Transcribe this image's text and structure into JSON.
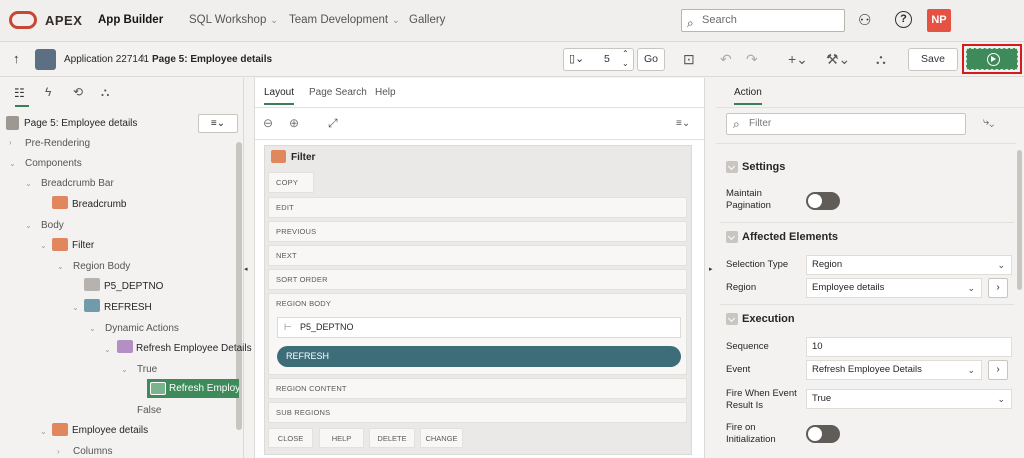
{
  "topnav": {
    "brand": "APEX",
    "items": [
      {
        "label": "App Builder",
        "active": true
      },
      {
        "label": "SQL Workshop",
        "active": false
      },
      {
        "label": "Team Development",
        "active": false
      },
      {
        "label": "Gallery",
        "active": false
      }
    ],
    "search_placeholder": "Search",
    "avatar_initials": "NP"
  },
  "toolbar": {
    "application": "Application 227141",
    "separator": "\\",
    "page": "Page 5: Employee details",
    "page_number": "5",
    "go_label": "Go",
    "save_label": "Save"
  },
  "left": {
    "title": "Page 5: Employee details",
    "tree": [
      {
        "label": "Pre-Rendering"
      },
      {
        "label": "Components"
      },
      {
        "label": "Breadcrumb Bar"
      },
      {
        "label": "Breadcrumb"
      },
      {
        "label": "Body"
      },
      {
        "label": "Filter"
      },
      {
        "label": "Region Body"
      },
      {
        "label": "P5_DEPTNO"
      },
      {
        "label": "REFRESH"
      },
      {
        "label": "Dynamic Actions"
      },
      {
        "label": "Refresh Employee Details"
      },
      {
        "label": "True"
      },
      {
        "label": "Refresh Employee"
      },
      {
        "label": "False"
      },
      {
        "label": "Employee details"
      },
      {
        "label": "Columns"
      }
    ]
  },
  "middle": {
    "tabs": [
      "Layout",
      "Page Search",
      "Help"
    ],
    "region_title": "Filter",
    "slots": [
      "COPY",
      "EDIT",
      "PREVIOUS",
      "NEXT",
      "SORT ORDER",
      "REGION BODY",
      "REGION CONTENT",
      "SUB REGIONS"
    ],
    "item": "P5_DEPTNO",
    "button": "REFRESH",
    "bottom_buttons": [
      "CLOSE",
      "HELP",
      "DELETE",
      "CHANGE"
    ]
  },
  "right": {
    "tab": "Action",
    "filter_placeholder": "Filter",
    "sections": {
      "settings": "Settings",
      "affected": "Affected Elements",
      "execution": "Execution"
    },
    "props": {
      "maintain_pagination": "Maintain Pagination",
      "selection_type_label": "Selection Type",
      "selection_type_value": "Region",
      "region_label": "Region",
      "region_value": "Employee details",
      "sequence_label": "Sequence",
      "sequence_value": "10",
      "event_label": "Event",
      "event_value": "Refresh Employee Details",
      "fire_when_label": "Fire When Event Result Is",
      "fire_when_value": "True",
      "fire_init_label": "Fire on Initialization"
    }
  },
  "colors": {
    "accent": "#3f8a5a",
    "brand": "#c74634",
    "button": "#3e6d7a"
  }
}
